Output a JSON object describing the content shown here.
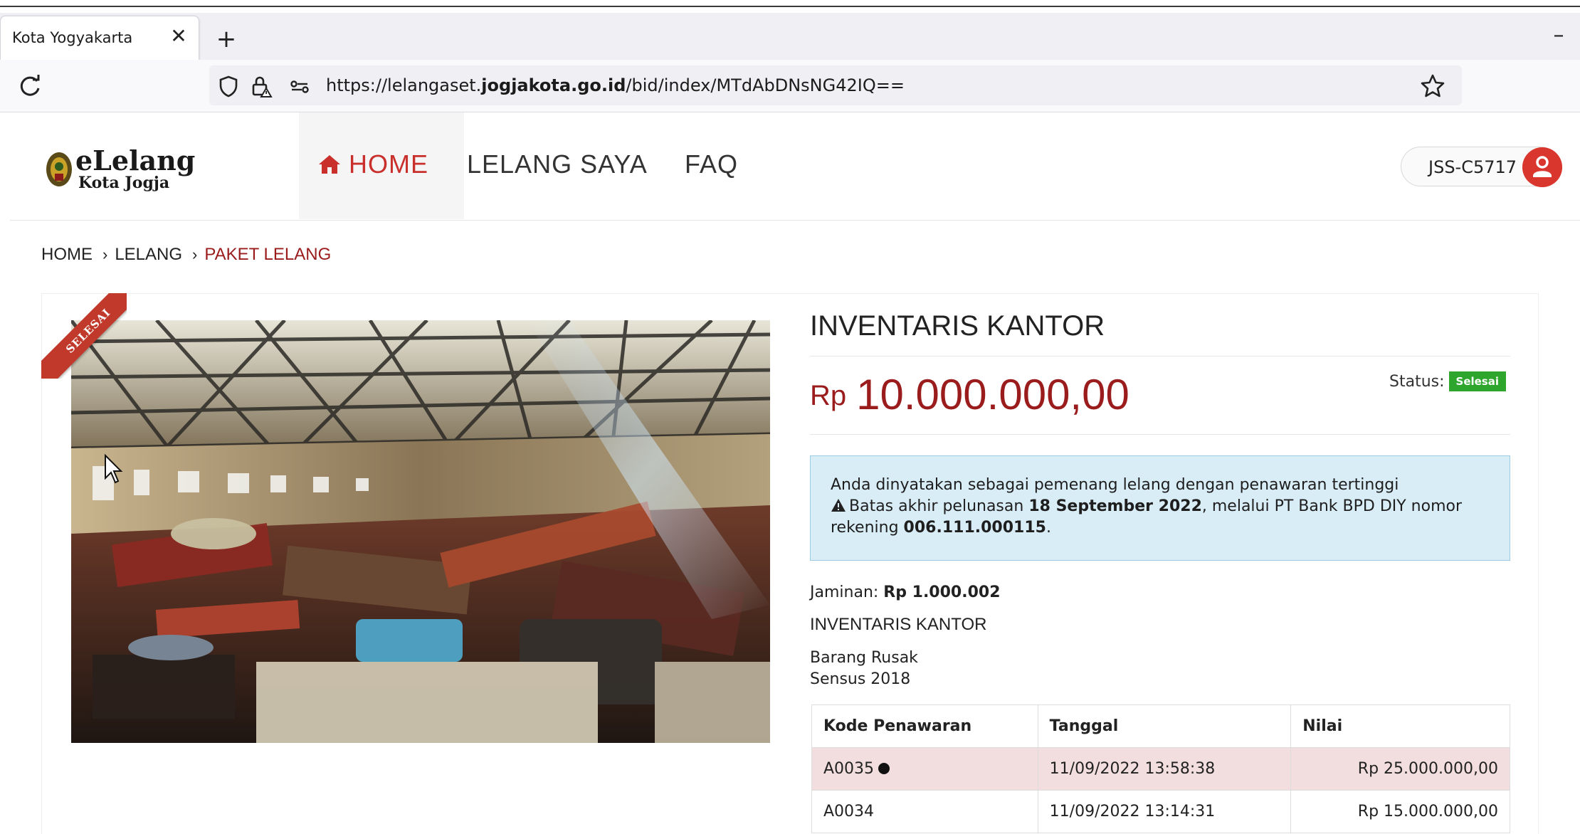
{
  "browser": {
    "tab_title": "Kota Yogyakarta",
    "tab_close": "✕",
    "new_tab": "+",
    "minimize": "–",
    "url_prefix": "https://lelangaset.",
    "url_domain": "jogjakota.go.id",
    "url_path": "/bid/index/MTdAbDNsNG42IQ=="
  },
  "header": {
    "logo_main": "eLelang",
    "logo_sub": "Kota Jogja",
    "menu": {
      "home": "HOME",
      "lelang_saya": "LELANG SAYA",
      "faq": "FAQ"
    },
    "user_code": "JSS-C5717",
    "accent_color": "#c9302c"
  },
  "breadcrumb": {
    "items": [
      "HOME",
      "LELANG",
      "PAKET LELANG"
    ],
    "separator": "›"
  },
  "ribbon": "SELESAI",
  "item": {
    "title": "INVENTARIS KANTOR",
    "currency": "Rp",
    "price": "10.000.000,00",
    "status_label": "Status:",
    "status_value": "Selesai",
    "status_color": "#2ea62e",
    "alert": {
      "line1": "Anda dinyatakan sebagai pemenang lelang dengan penawaran tertinggi",
      "line2_pre": "Batas akhir pelunasan ",
      "line2_date": "18 September 2022",
      "line2_post": ", melalui PT Bank BPD DIY nomor",
      "line3_pre": "rekening ",
      "line3_acct": "006.111.000115",
      "line3_post": "."
    },
    "jaminan_label": "Jaminan:",
    "jaminan_value": "Rp 1.000.002",
    "desc_title": "INVENTARIS KANTOR",
    "desc_line1": "Barang Rusak",
    "desc_line2": "Sensus 2018"
  },
  "bids": {
    "headers": [
      "Kode Penawaran",
      "Tanggal",
      "Nilai"
    ],
    "rows": [
      {
        "kode": "A0035",
        "tanggal": "11/09/2022 13:58:38",
        "nilai": "Rp 25.000.000,00",
        "winner": true
      },
      {
        "kode": "A0034",
        "tanggal": "11/09/2022 13:14:31",
        "nilai": "Rp 15.000.000,00",
        "winner": false
      }
    ]
  }
}
